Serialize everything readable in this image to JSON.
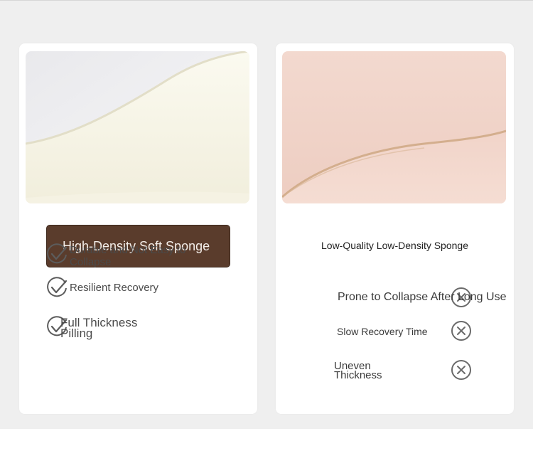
{
  "left_card": {
    "title": "High-Density Soft Sponge",
    "image": "white-foam-photo",
    "features": [
      {
        "icon": "check-circle-icon",
        "text": "Durable and Not Easy to Collapse"
      },
      {
        "icon": "check-circle-icon",
        "text": "Resilient Recovery"
      },
      {
        "icon": "check-circle-icon",
        "text": "Full Thickness Pilling"
      }
    ]
  },
  "right_card": {
    "title": "Low-Quality Low-Density Sponge",
    "image": "pink-foam-photo",
    "features": [
      {
        "icon": "x-circle-icon",
        "text": "Prone to Collapse After Long Use"
      },
      {
        "icon": "x-circle-icon",
        "text": "Slow Recovery Time"
      },
      {
        "icon": "x-circle-icon",
        "text": "Uneven Thickness"
      }
    ]
  },
  "colors": {
    "badge": "#5a3c2c",
    "background": "#efefef",
    "card": "#ffffff"
  }
}
